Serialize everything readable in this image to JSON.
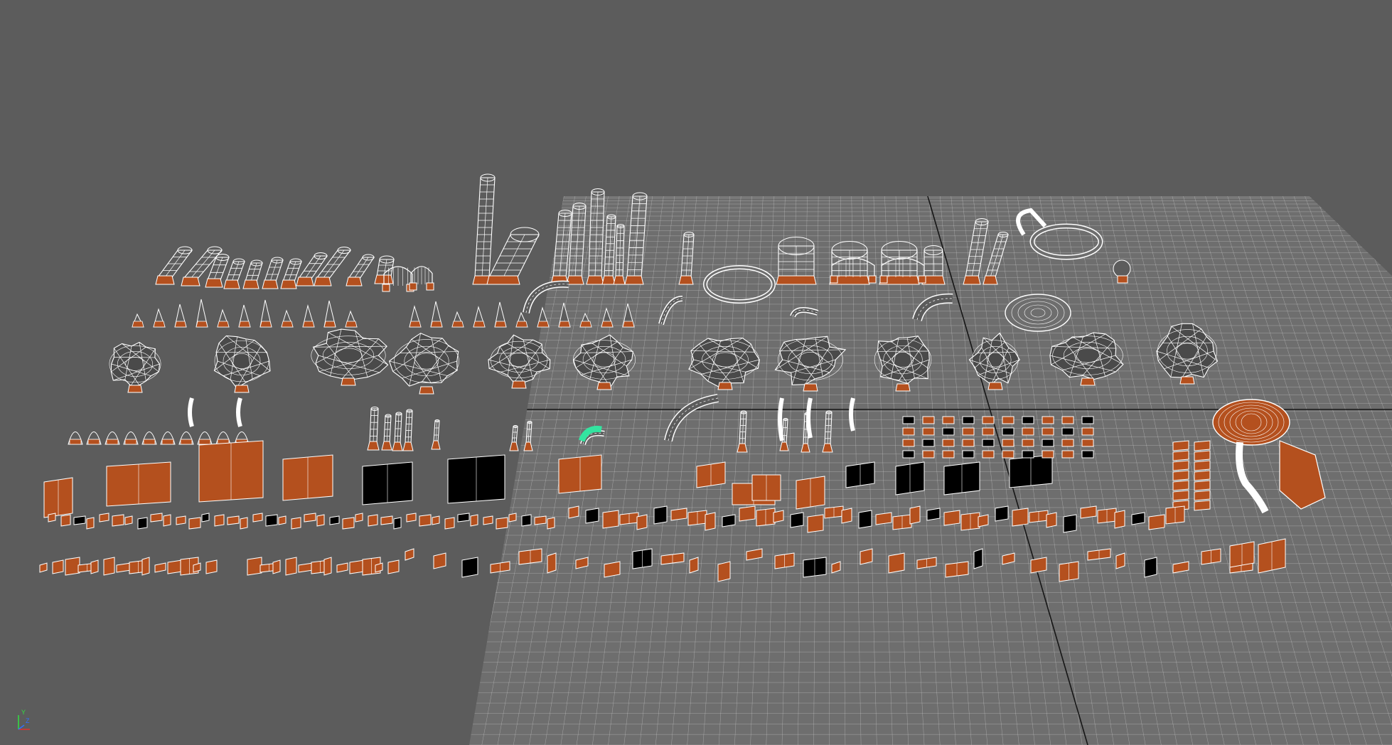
{
  "viewport": {
    "background_color": "#5c5c5c",
    "grid_fill_color": "#6e6e6e",
    "grid_line_color": "#d2d2d2",
    "grid_axis_color": "#161616",
    "wire_color": "#ffffff",
    "face_color": "#b4501e",
    "dark_face_color": "#000000",
    "selection_color": "#33e4a0"
  },
  "axis_gizmo": {
    "icon": "xyz-axis-icon",
    "y_label": "Y",
    "z_label": "Z",
    "x_color": "#e03030",
    "y_color": "#30e040",
    "z_color": "#3070ff"
  }
}
